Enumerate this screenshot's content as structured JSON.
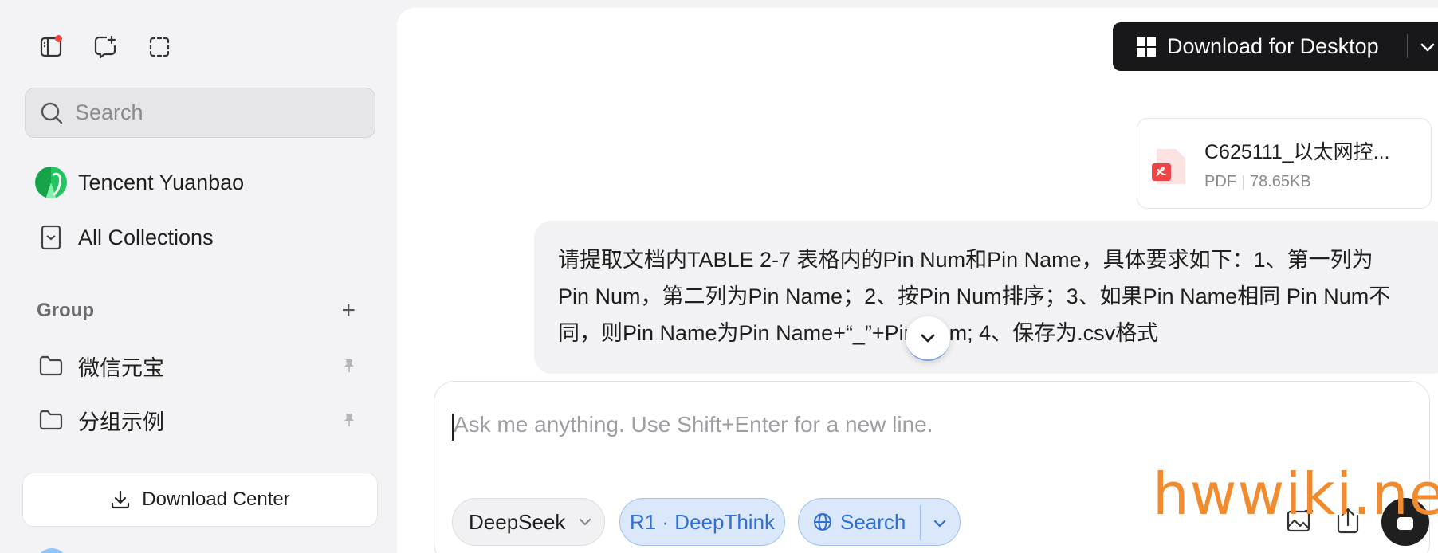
{
  "sidebar": {
    "search_placeholder": "Search",
    "nav": {
      "yuanbao_label": "Tencent Yuanbao",
      "collections_label": "All Collections"
    },
    "group": {
      "title": "Group",
      "add_symbol": "+",
      "items": [
        {
          "label": "微信元宝",
          "icon": "folder-icon",
          "pinned": true
        },
        {
          "label": "分组示例",
          "icon": "folder-icon",
          "pinned": true
        }
      ]
    },
    "download_center_label": "Download Center"
  },
  "header": {
    "download_desktop_label": "Download for Desktop"
  },
  "conversation": {
    "attachment": {
      "file_name": "C625111_以太网控...",
      "file_type": "PDF",
      "file_size": "78.65KB"
    },
    "user_message": "请提取文档内TABLE 2-7 表格内的Pin Num和Pin Name，具体要求如下：1、第一列为Pin Num，第二列为Pin Name；2、按Pin Num排序；3、如果Pin Name相同 Pin Num不同，则Pin Name为Pin Name+“_”+Pin Num; 4、保存为.csv格式"
  },
  "composer": {
    "placeholder": "Ask me anything. Use Shift+Enter for a new line.",
    "model_label": "DeepSeek",
    "deepthink_label": "R1 · DeepThink",
    "search_label": "Search"
  },
  "watermark": "hwwiki.net",
  "colors": {
    "accent_blue": "#2f6fd6",
    "chip_blue_bg": "#dbe8fc",
    "dark_button": "#18181b",
    "notification_red": "#ef4444",
    "watermark_orange": "#f28a2e"
  }
}
